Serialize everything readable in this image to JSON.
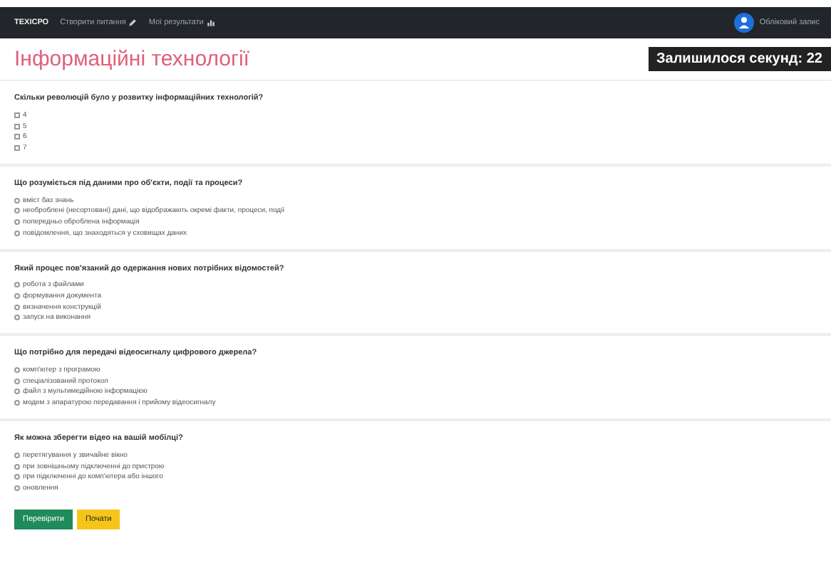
{
  "navbar": {
    "brand": "ТЕХІСРО",
    "links": [
      {
        "label": "Створити питання",
        "kind": "edit"
      },
      {
        "label": "Мої результати",
        "kind": "results"
      }
    ],
    "user": "Обліковий запис"
  },
  "title": "Інформаційні технології",
  "timer": "Залишилося секунд: 22",
  "questions": [
    {
      "text": "Скільки революцій було у розвитку інформаційних технологій?",
      "kind": "checkbox",
      "options": [
        {
          "label": "4",
          "checked": false
        },
        {
          "label": "5",
          "checked": false
        },
        {
          "label": "6",
          "checked": false
        },
        {
          "label": "7",
          "checked": false
        }
      ]
    },
    {
      "text": "Що розуміється під даними про об'єкти, події та процеси?",
      "kind": "radio",
      "options": [
        {
          "label": "вміст баз знань",
          "checked": false
        },
        {
          "label": "необроблені (несортовані) дані, що відображають окремі факти, процеси, події",
          "checked": false
        },
        {
          "label": "попередньо оброблена інформація",
          "checked": false
        },
        {
          "label": "повідомлення, що знаходяться у сховищах даних",
          "checked": false
        }
      ]
    },
    {
      "text": "Який процес пов'язаний до одержання нових потрібних відомостей?",
      "kind": "radio",
      "options": [
        {
          "label": "робота з файлами",
          "checked": false
        },
        {
          "label": "формування документа",
          "checked": false
        },
        {
          "label": "визначення конструкцій",
          "checked": false
        },
        {
          "label": "запуск на виконання",
          "checked": false
        }
      ]
    },
    {
      "text": "Що потрібно для передачі відеосигналу цифрового джерела?",
      "kind": "radio",
      "options": [
        {
          "label": "комп'ютер з програмою",
          "checked": false
        },
        {
          "label": "спеціалізований протокол",
          "checked": false
        },
        {
          "label": "файл з мультимедійною інформацією",
          "checked": false
        },
        {
          "label": "модем з апаратурою передавання і прийому відеосигналу",
          "checked": false
        }
      ]
    },
    {
      "text": "Як можна зберегти відео на вашій мобілці?",
      "kind": "radio",
      "options": [
        {
          "label": "перетягування у звичайне вікно",
          "checked": false
        },
        {
          "label": "при зовнішньому підключенні до пристрою",
          "checked": false
        },
        {
          "label": "при підключенні до комп'ютера або іншого",
          "checked": false
        },
        {
          "label": "оновлення",
          "checked": false
        }
      ]
    }
  ],
  "buttons": [
    {
      "label": "Перевірити",
      "kind": "primary"
    },
    {
      "label": "Почати",
      "kind": "warning"
    }
  ]
}
